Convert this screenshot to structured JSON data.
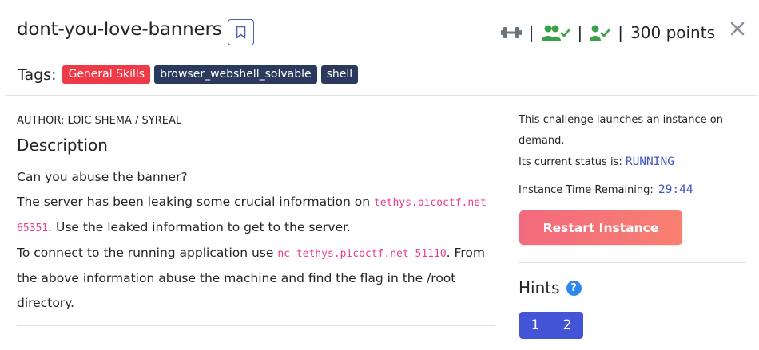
{
  "challenge": {
    "title": "dont-you-love-banners",
    "points": "300 points",
    "author": "AUTHOR: LOIC SHEMA / SYREAL"
  },
  "stats": {
    "sep": "|",
    "icons": [
      "dumbbell-icon",
      "users-check-icon",
      "user-check-icon"
    ],
    "accent_color": "#3aa14a"
  },
  "tags": {
    "label": "Tags:",
    "items": [
      {
        "label": "General Skills",
        "color": "#f03a47"
      },
      {
        "label": "browser_webshell_solvable",
        "color": "#2b3a5c"
      },
      {
        "label": "shell",
        "color": "#2b3a5c"
      }
    ]
  },
  "description": {
    "heading": "Description",
    "line1": "Can you abuse the banner?",
    "line2_pre": "The server has been leaking some crucial information on ",
    "line2_code": "tethys.picoctf.net 65351",
    "line2_post": ". Use the leaked information to get to the server.",
    "line3_pre": "To connect to the running application use ",
    "line3_code": "nc tethys.picoctf.net 51110",
    "line3_post": ". From the above information abuse the machine and find the flag in the /root directory."
  },
  "instance": {
    "launch_text": "This challenge launches an instance on demand.",
    "status_label": "Its current status is: ",
    "status_value": "RUNNING",
    "time_label": "Instance Time Remaining: ",
    "time_value": "29:44",
    "restart_label": "Restart Instance"
  },
  "hints": {
    "heading": "Hints",
    "help": "?",
    "items": [
      "1",
      "2"
    ]
  }
}
